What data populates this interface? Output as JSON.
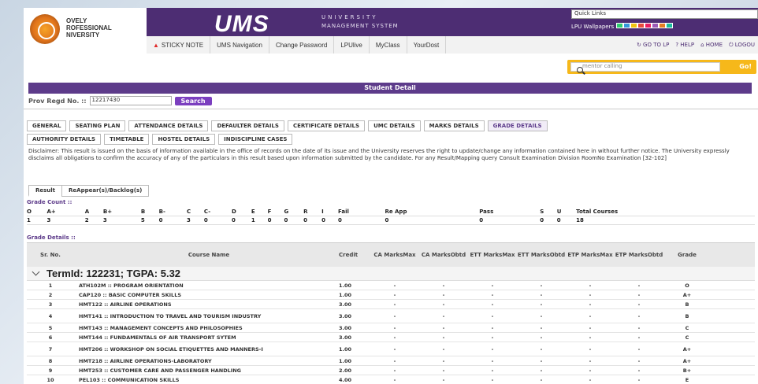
{
  "header": {
    "logo_lines": [
      "OVELY",
      "ROFESSIONAL",
      "NIVERSITY"
    ],
    "ums_logo": "UMS",
    "ums_sub1": "UNIVERSITY",
    "ums_sub2": "MANAGEMENT SYSTEM",
    "quick_links": "Quick Links",
    "wallpapers_label": "LPU Wallpapers",
    "wallpaper_colors": [
      "#2ecc71",
      "#3498db",
      "#f1c40f",
      "#e74c3c",
      "#e91e63",
      "#9b59b6",
      "#e67e22",
      "#1abc9c"
    ]
  },
  "nav": {
    "items": [
      "STICKY NOTE",
      "UMS Navigation",
      "Change Password",
      "LPUlive",
      "MyClass",
      "YourDost"
    ]
  },
  "toplinks": [
    "GO TO LP",
    "HELP",
    "HOME",
    "LOGOU"
  ],
  "search": {
    "placeholder": "mentor calling",
    "go": "Go!"
  },
  "student_detail_title": "Student Detail",
  "reg": {
    "label": "Prov Regd No. ::",
    "value": "12217430",
    "button": "Search"
  },
  "tabs": {
    "row1": [
      "GENERAL",
      "SEATING PLAN",
      "ATTENDANCE DETAILS",
      "DEFAULTER DETAILS",
      "CERTIFICATE DETAILS",
      "UMC DETAILS",
      "MARKS DETAILS",
      "GRADE DETAILS"
    ],
    "row2": [
      "AUTHORITY DETAILS",
      "TIMETABLE",
      "HOSTEL DETAILS",
      "INDISCIPLINE CASES"
    ]
  },
  "disclaimer": "Disclaimer: This result is issued on the basis of information available in the office of records on the date of its issue and the University reserves the right to update/change any information contained here in without further notice. The University expressly disclaims all obligations to confirm the accuracy of any of the particulars in this result based upon information submitted by the candidate. For any Result/Mapping query Consult Examination Division RoomNo Examination [32-102]",
  "subtabs": [
    "Result",
    "ReAppear(s)/Backlog(s)"
  ],
  "grade_count": {
    "title": "Grade Count ::",
    "headers": [
      "O",
      "A+",
      "A",
      "B+",
      "B",
      "B-",
      "C",
      "C-",
      "D",
      "E",
      "F",
      "G",
      "R",
      "I",
      "Fail",
      "Re App",
      "Pass",
      "S",
      "U",
      "Total Courses"
    ],
    "values": [
      "1",
      "3",
      "2",
      "3",
      "5",
      "0",
      "3",
      "0",
      "0",
      "1",
      "0",
      "0",
      "0",
      "0",
      "0",
      "0",
      "0",
      "0",
      "0",
      "18"
    ]
  },
  "grade_details": {
    "title": "Grade Details ::",
    "headers": [
      "Sr. No.",
      "Course Name",
      "Credit",
      "CA MarksMax",
      "CA MarksObtd",
      "ETT MarksMax",
      "ETT MarksObtd",
      "ETP MarksMax",
      "ETP MarksObtd",
      "Grade"
    ],
    "term": "TermId: 122231; TGPA: 5.32",
    "rows": [
      {
        "sr": "1",
        "course": "ATH102M :: PROGRAM ORIENTATION",
        "credit": "1.00",
        "grade": "O"
      },
      {
        "sr": "2",
        "course": "CAP120 :: BASIC COMPUTER SKILLS",
        "credit": "1.00",
        "grade": "A+"
      },
      {
        "sr": "3",
        "course": "HMT122 :: AIRLINE OPERATIONS",
        "credit": "3.00",
        "grade": "B"
      },
      {
        "sr": "4",
        "course": "HMT141 :: INTRODUCTION TO TRAVEL AND TOURISM INDUSTRY",
        "credit": "3.00",
        "grade": "B"
      },
      {
        "sr": "5",
        "course": "HMT143 :: MANAGEMENT CONCEPTS AND PHILOSOPHIES",
        "credit": "3.00",
        "grade": "C"
      },
      {
        "sr": "6",
        "course": "HMT144 :: FUNDAMENTALS OF AIR TRANSPORT SYTEM",
        "credit": "3.00",
        "grade": "C"
      },
      {
        "sr": "7",
        "course": "HMT206 :: WORKSHOP ON SOCIAL ETIQUETTES AND MANNERS-I",
        "credit": "1.00",
        "grade": "A+"
      },
      {
        "sr": "8",
        "course": "HMT218 :: AIRLINE OPERATIONS-LABORATORY",
        "credit": "1.00",
        "grade": "A+"
      },
      {
        "sr": "9",
        "course": "HMT253 :: CUSTOMER CARE AND PASSENGER HANDLING",
        "credit": "2.00",
        "grade": "B+"
      },
      {
        "sr": "10",
        "course": "PEL103 :: COMMUNICATION SKILLS",
        "credit": "4.00",
        "grade": "E"
      }
    ],
    "dash": "-"
  }
}
